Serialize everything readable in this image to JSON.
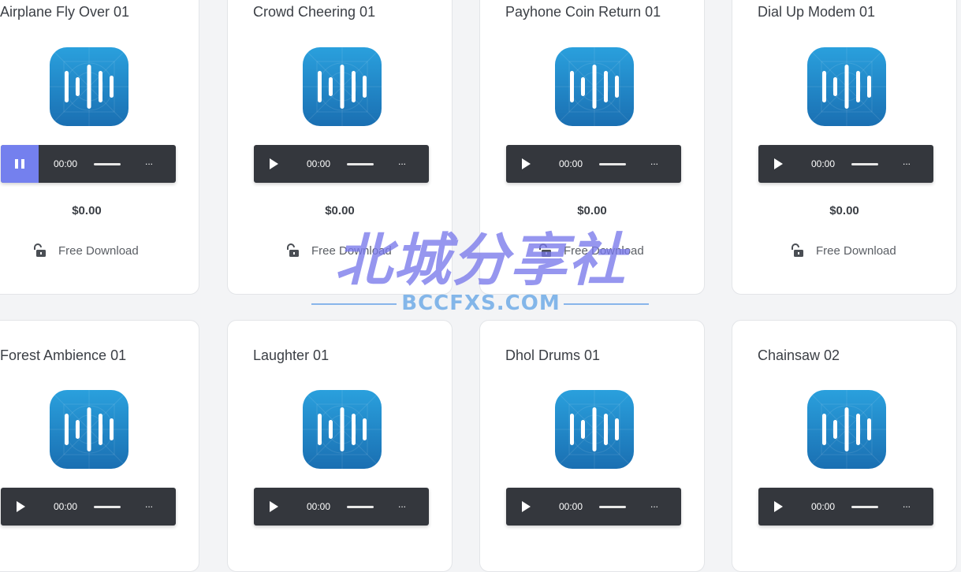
{
  "price": "$0.00",
  "download_label": "Free Download",
  "player": {
    "time": "00:00",
    "more": "..."
  },
  "cards": [
    {
      "title": "Airplane Fly Over 01",
      "playing": true
    },
    {
      "title": "Crowd Cheering 01",
      "playing": false
    },
    {
      "title": "Payhone Coin Return 01",
      "playing": false
    },
    {
      "title": "Dial Up Modem 01",
      "playing": false
    },
    {
      "title": "Forest Ambience 01",
      "playing": false
    },
    {
      "title": "Laughter 01",
      "playing": false
    },
    {
      "title": "Dhol Drums 01",
      "playing": false
    },
    {
      "title": "Chainsaw 02",
      "playing": false
    }
  ],
  "icons": {
    "app": "sound-wave-icon",
    "play": "play-icon",
    "pause": "pause-icon",
    "download": "unlock-icon"
  },
  "colors": {
    "accent": "#7480ee",
    "player_bg": "#34373d",
    "icon_top": "#2aa0dd",
    "icon_bottom": "#1a6fb2"
  },
  "watermark": {
    "cn": "北城分享社",
    "en": "BCCFXS.COM"
  }
}
